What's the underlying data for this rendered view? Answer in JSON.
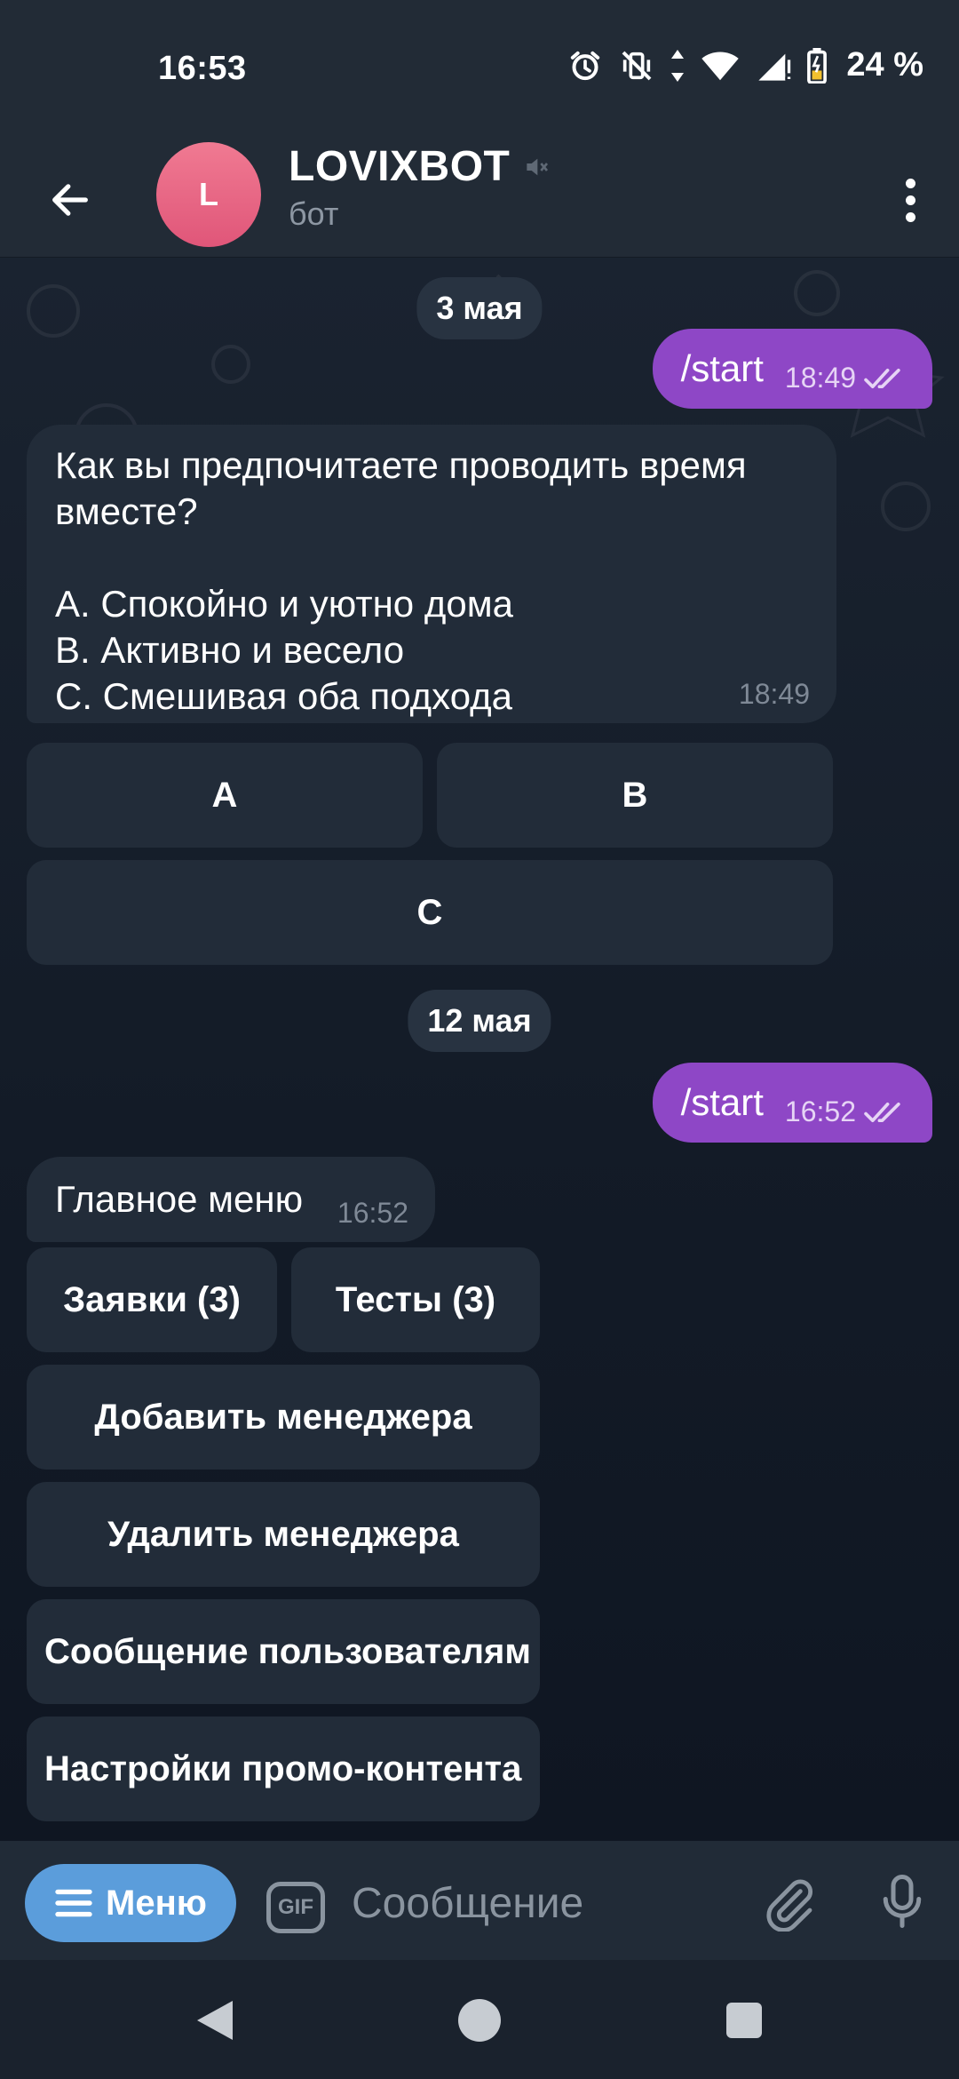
{
  "status": {
    "time": "16:53",
    "battery": "24 %",
    "icons": [
      "alarm-icon",
      "vibrate-off-icon",
      "data-arrows-icon",
      "wifi-icon",
      "signal-icon",
      "battery-icon"
    ]
  },
  "header": {
    "avatar_letter": "L",
    "title": "LOVIXBOT",
    "subtitle": "бот",
    "colors": {
      "avatar": "#e86a87",
      "bar": "#222b36"
    }
  },
  "chat": {
    "date1": "3 мая",
    "msg1": {
      "text": "/start",
      "time": "18:49"
    },
    "msg2": {
      "text": "Как вы предпочитаете проводить время\nвместе?\n\nA. Спокойно и уютно дома\nB. Активно и весело\nC. Смешивая оба подхода",
      "time": "18:49"
    },
    "kb1": {
      "a": "A",
      "b": "B",
      "c": "C"
    },
    "date2": "12 мая",
    "msg3": {
      "text": "/start",
      "time": "16:52"
    },
    "msg4": {
      "text": "Главное меню",
      "time": "16:52"
    },
    "kb2": {
      "requests": "Заявки (3)",
      "tests": "Тесты (3)",
      "add_manager": "Добавить менеджера",
      "remove_manager": "Удалить менеджера",
      "message_users": "Сообщение пользователям",
      "promo_settings": "Настройки промо-контента"
    },
    "colors": {
      "outgoing": "#8e47c6",
      "incoming": "#222c39"
    }
  },
  "input": {
    "menu_label": "Меню",
    "gif_label": "GIF",
    "placeholder": "Сообщение",
    "colors": {
      "menu": "#5b9ddb"
    }
  }
}
